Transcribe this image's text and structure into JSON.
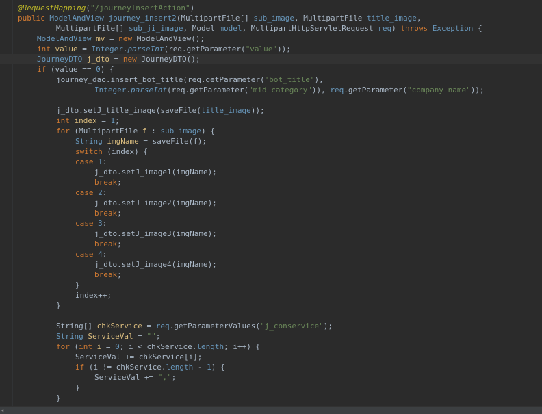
{
  "lines": [
    {
      "indent": 0,
      "segments": [
        [
          "ann",
          "@RequestMapping"
        ],
        [
          "plain",
          "("
        ],
        [
          "str",
          "\"/journeyInsertAction\""
        ],
        [
          "plain",
          ")"
        ]
      ]
    },
    {
      "indent": 0,
      "segments": [
        [
          "kw",
          "public "
        ],
        [
          "ty",
          "ModelAndView "
        ],
        [
          "ty",
          "journey_insert2"
        ],
        [
          "plain",
          "(MultipartFile[] "
        ],
        [
          "ty",
          "sub_image"
        ],
        [
          "plain",
          ", MultipartFile "
        ],
        [
          "ty",
          "title_image"
        ],
        [
          "plain",
          ","
        ]
      ]
    },
    {
      "indent": 2,
      "segments": [
        [
          "plain",
          "MultipartFile[] "
        ],
        [
          "ty",
          "sub_ji_image"
        ],
        [
          "plain",
          ", Model "
        ],
        [
          "ty",
          "model"
        ],
        [
          "plain",
          ", MultipartHttpServletRequest "
        ],
        [
          "ty",
          "req"
        ],
        [
          "plain",
          ") "
        ],
        [
          "kw",
          "throws "
        ],
        [
          "ty",
          "Exception"
        ],
        [
          "plain",
          " {"
        ]
      ]
    },
    {
      "indent": 1,
      "segments": [
        [
          "ty",
          "ModelAndView "
        ],
        [
          "nm",
          "mv"
        ],
        [
          "plain",
          " = "
        ],
        [
          "kw",
          "new "
        ],
        [
          "plain",
          "ModelAndView();"
        ]
      ]
    },
    {
      "indent": 1,
      "segments": [
        [
          "kw",
          "int "
        ],
        [
          "nm",
          "value"
        ],
        [
          "plain",
          " = "
        ],
        [
          "ty",
          "Integer"
        ],
        [
          "plain",
          "."
        ],
        [
          "ty it",
          "parseInt"
        ],
        [
          "plain",
          "(req.getParameter("
        ],
        [
          "str",
          "\"value\""
        ],
        [
          "plain",
          "));"
        ]
      ]
    },
    {
      "indent": 1,
      "current": true,
      "segments": [
        [
          "ty",
          "JourneyDTO "
        ],
        [
          "nm",
          "j_dto"
        ],
        [
          "plain",
          " = "
        ],
        [
          "kw",
          "new "
        ],
        [
          "plain",
          "JourneyDTO();"
        ]
      ]
    },
    {
      "indent": 1,
      "segments": [
        [
          "kw",
          "if "
        ],
        [
          "plain",
          "(value == "
        ],
        [
          "num",
          "0"
        ],
        [
          "plain",
          ") {"
        ]
      ]
    },
    {
      "indent": 2,
      "segments": [
        [
          "plain",
          "journey_dao.insert_bot_title(req.getParameter("
        ],
        [
          "str",
          "\"bot_title\""
        ],
        [
          "plain",
          "),"
        ]
      ]
    },
    {
      "indent": 4,
      "segments": [
        [
          "ty",
          "Integer"
        ],
        [
          "plain",
          "."
        ],
        [
          "ty it",
          "parseInt"
        ],
        [
          "plain",
          "(req.getParameter("
        ],
        [
          "str",
          "\"mid_category\""
        ],
        [
          "plain",
          ")), "
        ],
        [
          "ty",
          "req"
        ],
        [
          "plain",
          ".getParameter("
        ],
        [
          "str",
          "\"company_name\""
        ],
        [
          "plain",
          "));"
        ]
      ]
    },
    {
      "indent": 0,
      "segments": []
    },
    {
      "indent": 2,
      "segments": [
        [
          "plain",
          "j_dto.setJ_title_image(saveFile("
        ],
        [
          "ty",
          "title_image"
        ],
        [
          "plain",
          "));"
        ]
      ]
    },
    {
      "indent": 2,
      "segments": [
        [
          "kw",
          "int "
        ],
        [
          "nm",
          "index"
        ],
        [
          "plain",
          " = "
        ],
        [
          "num",
          "1"
        ],
        [
          "plain",
          ";"
        ]
      ]
    },
    {
      "indent": 2,
      "segments": [
        [
          "kw",
          "for "
        ],
        [
          "plain",
          "(MultipartFile "
        ],
        [
          "nm",
          "f"
        ],
        [
          "plain",
          " : "
        ],
        [
          "ty",
          "sub_image"
        ],
        [
          "plain",
          ") {"
        ]
      ]
    },
    {
      "indent": 3,
      "segments": [
        [
          "ty",
          "String "
        ],
        [
          "nm",
          "imgName"
        ],
        [
          "plain",
          " = saveFile(f);"
        ]
      ]
    },
    {
      "indent": 3,
      "segments": [
        [
          "kw",
          "switch "
        ],
        [
          "plain",
          "(index) {"
        ]
      ]
    },
    {
      "indent": 3,
      "segments": [
        [
          "kw",
          "case "
        ],
        [
          "num",
          "1"
        ],
        [
          "plain",
          ":"
        ]
      ]
    },
    {
      "indent": 4,
      "segments": [
        [
          "plain",
          "j_dto.setJ_image1(imgName);"
        ]
      ]
    },
    {
      "indent": 4,
      "segments": [
        [
          "kw",
          "break"
        ],
        [
          "plain",
          ";"
        ]
      ]
    },
    {
      "indent": 3,
      "segments": [
        [
          "kw",
          "case "
        ],
        [
          "num",
          "2"
        ],
        [
          "plain",
          ":"
        ]
      ]
    },
    {
      "indent": 4,
      "segments": [
        [
          "plain",
          "j_dto.setJ_image2(imgName);"
        ]
      ]
    },
    {
      "indent": 4,
      "segments": [
        [
          "kw",
          "break"
        ],
        [
          "plain",
          ";"
        ]
      ]
    },
    {
      "indent": 3,
      "segments": [
        [
          "kw",
          "case "
        ],
        [
          "num",
          "3"
        ],
        [
          "plain",
          ":"
        ]
      ]
    },
    {
      "indent": 4,
      "segments": [
        [
          "plain",
          "j_dto.setJ_image3(imgName);"
        ]
      ]
    },
    {
      "indent": 4,
      "segments": [
        [
          "kw",
          "break"
        ],
        [
          "plain",
          ";"
        ]
      ]
    },
    {
      "indent": 3,
      "segments": [
        [
          "kw",
          "case "
        ],
        [
          "num",
          "4"
        ],
        [
          "plain",
          ":"
        ]
      ]
    },
    {
      "indent": 4,
      "segments": [
        [
          "plain",
          "j_dto.setJ_image4(imgName);"
        ]
      ]
    },
    {
      "indent": 4,
      "segments": [
        [
          "kw",
          "break"
        ],
        [
          "plain",
          ";"
        ]
      ]
    },
    {
      "indent": 3,
      "segments": [
        [
          "plain",
          "}"
        ]
      ]
    },
    {
      "indent": 3,
      "segments": [
        [
          "plain",
          "index++;"
        ]
      ]
    },
    {
      "indent": 2,
      "segments": [
        [
          "plain",
          "}"
        ]
      ]
    },
    {
      "indent": 0,
      "segments": []
    },
    {
      "indent": 2,
      "segments": [
        [
          "plain",
          "String[] "
        ],
        [
          "nm",
          "chkService"
        ],
        [
          "plain",
          " = "
        ],
        [
          "ty",
          "req"
        ],
        [
          "plain",
          ".getParameterValues("
        ],
        [
          "str",
          "\"j_conservice\""
        ],
        [
          "plain",
          ");"
        ]
      ]
    },
    {
      "indent": 2,
      "segments": [
        [
          "ty",
          "String "
        ],
        [
          "nm",
          "ServiceVal"
        ],
        [
          "plain",
          " = "
        ],
        [
          "str",
          "\"\""
        ],
        [
          "plain",
          ";"
        ]
      ]
    },
    {
      "indent": 2,
      "segments": [
        [
          "kw",
          "for "
        ],
        [
          "plain",
          "("
        ],
        [
          "kw",
          "int "
        ],
        [
          "nm",
          "i"
        ],
        [
          "plain",
          " = "
        ],
        [
          "num",
          "0"
        ],
        [
          "plain",
          "; i < chkService."
        ],
        [
          "ty",
          "length"
        ],
        [
          "plain",
          "; i++) {"
        ]
      ]
    },
    {
      "indent": 3,
      "segments": [
        [
          "plain",
          "ServiceVal += chkService[i];"
        ]
      ]
    },
    {
      "indent": 3,
      "segments": [
        [
          "kw",
          "if "
        ],
        [
          "plain",
          "(i != chkService."
        ],
        [
          "ty",
          "length"
        ],
        [
          "plain",
          " - "
        ],
        [
          "num",
          "1"
        ],
        [
          "plain",
          ") {"
        ]
      ]
    },
    {
      "indent": 4,
      "segments": [
        [
          "plain",
          "ServiceVal += "
        ],
        [
          "str",
          "\",\""
        ],
        [
          "plain",
          ";"
        ]
      ]
    },
    {
      "indent": 3,
      "segments": [
        [
          "plain",
          "}"
        ]
      ]
    },
    {
      "indent": 2,
      "segments": [
        [
          "plain",
          "}"
        ]
      ]
    }
  ],
  "scrollbar": {
    "arrow": "◀"
  }
}
